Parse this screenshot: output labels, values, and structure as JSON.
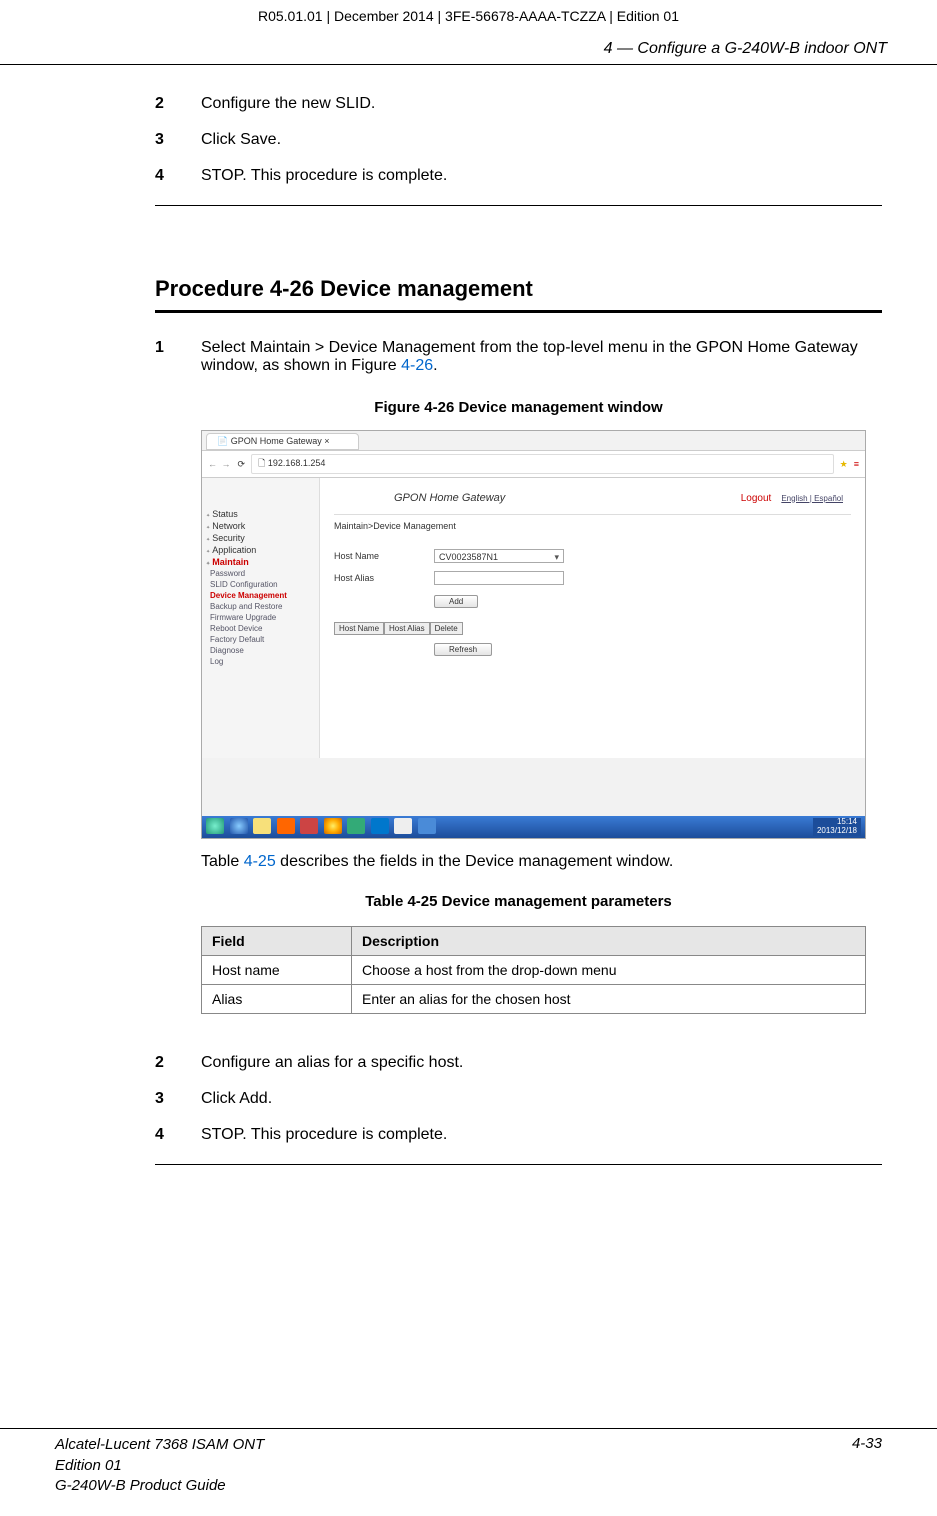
{
  "header": {
    "line": "R05.01.01 | December 2014 | 3FE-56678-AAAA-TCZZA | Edition 01"
  },
  "chapter": "4 —  Configure a G-240W-B indoor ONT",
  "steps_top": [
    {
      "num": "2",
      "text": "Configure the new SLID."
    },
    {
      "num": "3",
      "text": "Click Save."
    },
    {
      "num": "4",
      "text": "STOP. This procedure is complete."
    }
  ],
  "procedure": {
    "title": "Procedure 4-26  Device management",
    "step1": {
      "num": "1",
      "text_pre": "Select Maintain > Device Management from the top-level menu in the GPON Home Gateway window, as shown in Figure ",
      "link": "4-26",
      "text_post": "."
    }
  },
  "figure": {
    "caption": "Figure 4-26  Device management window",
    "tab_title": "GPON Home Gateway",
    "url": "192.168.1.254",
    "banner_title": "GPON Home Gateway",
    "logout": "Logout",
    "lang": "English | Español",
    "breadcrumb": "Maintain>Device Management",
    "sidebar_top": [
      "Status",
      "Network",
      "Security",
      "Application"
    ],
    "sidebar_maintain": "Maintain",
    "sidebar_sub": [
      "Password",
      "SLID Configuration",
      "Device Management",
      "Backup and Restore",
      "Firmware Upgrade",
      "Reboot Device",
      "Factory Default",
      "Diagnose",
      "Log"
    ],
    "form": {
      "host_name_label": "Host Name",
      "host_name_value": "CV0023587N1",
      "host_alias_label": "Host Alias",
      "add_btn": "Add",
      "thead": [
        "Host Name",
        "Host Alias",
        "Delete"
      ],
      "refresh_btn": "Refresh"
    },
    "clock": {
      "time": "15:14",
      "date": "2013/12/18"
    }
  },
  "post_figure": {
    "pre": "Table ",
    "link": "4-25",
    "post": " describes the fields in the Device management window."
  },
  "table": {
    "caption": "Table 4-25 Device management parameters",
    "headers": [
      "Field",
      "Description"
    ],
    "rows": [
      {
        "f": "Host name",
        "d": "Choose a host from the drop-down menu"
      },
      {
        "f": "Alias",
        "d": "Enter an alias for the chosen host"
      }
    ]
  },
  "steps_bottom": [
    {
      "num": "2",
      "text": "Configure an alias for a specific host."
    },
    {
      "num": "3",
      "text": "Click Add."
    },
    {
      "num": "4",
      "text": "STOP. This procedure is complete."
    }
  ],
  "footer": {
    "l1": "Alcatel-Lucent 7368 ISAM ONT",
    "l2": "Edition 01",
    "l3": "G-240W-B Product Guide",
    "page": "4-33"
  }
}
